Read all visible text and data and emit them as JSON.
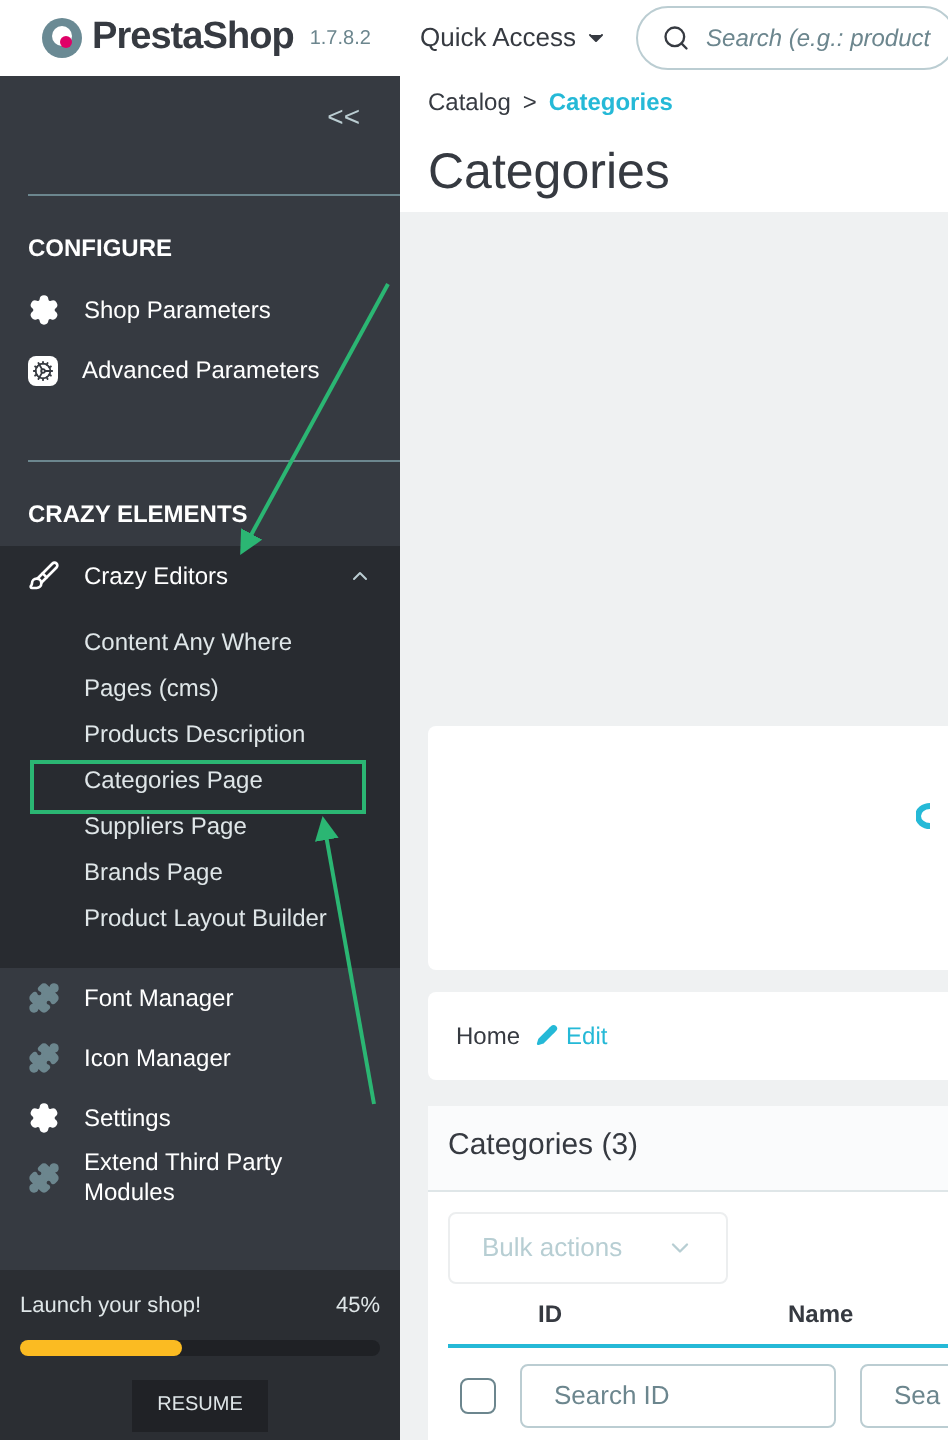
{
  "header": {
    "logo": "PrestaShop",
    "version": "1.7.8.2",
    "quick_access": "Quick Access",
    "search": {
      "placeholder": "Search (e.g.: product"
    }
  },
  "sidebar": {
    "collapse": "<<",
    "sections": [
      {
        "title": "CONFIGURE",
        "items": [
          {
            "label": "Shop Parameters",
            "kind": "gear"
          },
          {
            "label": "Advanced Parameters",
            "kind": "square-gear"
          }
        ]
      },
      {
        "title": "CRAZY ELEMENTS",
        "items": [
          {
            "label": "Crazy Editors",
            "kind": "brush",
            "expanded": true,
            "children": [
              {
                "label": "Content Any Where"
              },
              {
                "label": "Pages (cms)"
              },
              {
                "label": "Products Description"
              },
              {
                "label": "Categories Page"
              },
              {
                "label": "Suppliers Page"
              },
              {
                "label": "Brands Page"
              },
              {
                "label": "Product Layout Builder"
              }
            ]
          },
          {
            "label": "Font Manager",
            "kind": "puzzle"
          },
          {
            "label": "Icon Manager",
            "kind": "puzzle"
          },
          {
            "label": "Settings",
            "kind": "gear"
          },
          {
            "label": "Extend Third Party Modules",
            "kind": "puzzle"
          }
        ]
      }
    ],
    "onboarding": {
      "label": "Launch your shop!",
      "percent": "45%",
      "level": 0.45,
      "button": "RESUME"
    }
  },
  "main": {
    "breadcrumb": {
      "parent": "Catalog",
      "separator": ">",
      "current": "Categories"
    },
    "title": "Categories",
    "path_card": {
      "home": "Home",
      "edit": "Edit"
    },
    "list": {
      "title": "Categories (3)",
      "bulk_actions": "Bulk actions",
      "columns": [
        "ID",
        "Name"
      ],
      "select_all": {
        "checked": false
      },
      "filters": [
        {
          "placeholder": "Search ID"
        },
        {
          "placeholder": "Sea"
        }
      ]
    }
  }
}
